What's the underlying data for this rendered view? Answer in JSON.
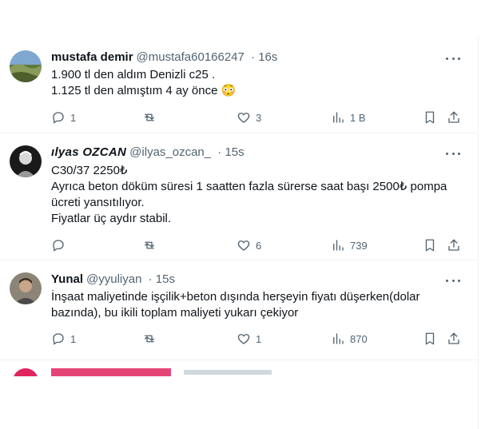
{
  "tweets": [
    {
      "display_name": "mustafa demir",
      "handle": "@mustafa60166247",
      "time": "16s",
      "lines": [
        "1.900 tl den aldım Denizli c25 .",
        "1.125 tl den almıştım 4 ay önce 😳"
      ],
      "replies": "1",
      "retweets": "",
      "likes": "3",
      "views": "1 B"
    },
    {
      "display_name": "ılyas OZCAN",
      "handle": "@ilyas_ozcan_",
      "time": "15s",
      "lines": [
        "C30/37 2250₺",
        "Ayrıca beton döküm süresi 1 saatten fazla sürerse saat başı 2500₺ pompa",
        "ücreti yansıtılıyor.",
        "Fiyatlar üç aydır stabil."
      ],
      "replies": "",
      "retweets": "",
      "likes": "6",
      "views": "739"
    },
    {
      "display_name": "Yunal",
      "handle": "@yyuliyan",
      "time": "15s",
      "lines": [
        "İnşaat maliyetinde işçilik+beton dışında herşeyin fiyatı düşerken(dolar",
        "bazında), bu ikili toplam maliyeti yukarı çekiyor"
      ],
      "replies": "1",
      "retweets": "",
      "likes": "1",
      "views": "870"
    }
  ],
  "icons": {
    "reply": "reply-icon",
    "retweet": "retweet-icon",
    "like": "like-icon",
    "views": "views-icon",
    "bookmark": "bookmark-icon",
    "share": "share-icon",
    "more": "more-icon"
  },
  "colors": {
    "secondary_text": "#536471",
    "divider": "#eff3f4",
    "partial_avatar": "#e0245e"
  }
}
